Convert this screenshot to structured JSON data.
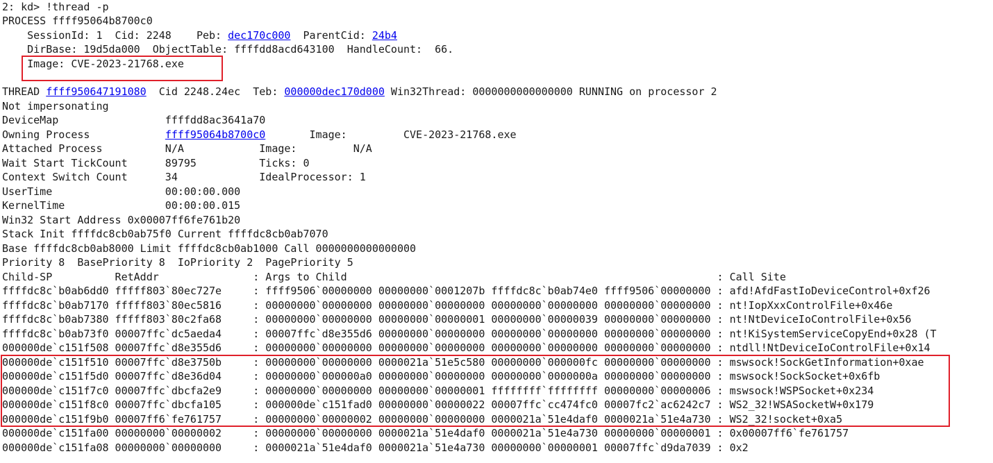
{
  "prompt": "2: kd> !thread -p",
  "process": {
    "label": "PROCESS ffff95064b8700c0",
    "session_pre": "    SessionId: 1  Cid: 2248    Peb: ",
    "peb_link": "dec170c000",
    "parentcid_pre": "  ParentCid: ",
    "parentcid_link": "24b4",
    "dirbase_line": "    DirBase: 19d5da000  ObjectTable: ffffdd8acd643100  HandleCount:  66.",
    "image_line": "    Image: CVE-2023-21768.exe"
  },
  "thread": {
    "pre": "THREAD ",
    "thread_link": "ffff950647191080",
    "cid_teb": "  Cid 2248.24ec  Teb: ",
    "teb_link": "000000dec170d000",
    "rest": " Win32Thread: 0000000000000000 RUNNING on processor 2",
    "impersonating": "Not impersonating",
    "devicemap": "DeviceMap                 ffffdd8ac3641a70",
    "owning_pre": "Owning Process            ",
    "owning_link": "ffff95064b8700c0",
    "owning_post": "       Image:         CVE-2023-21768.exe",
    "attached": "Attached Process          N/A            Image:         N/A",
    "waitstart": "Wait Start TickCount      89795          Ticks: 0",
    "ctxswitch": "Context Switch Count      34             IdealProcessor: 1",
    "usertime": "UserTime                  00:00:00.000",
    "kerneltime": "KernelTime                00:00:00.015",
    "win32start": "Win32 Start Address 0x00007ff6fe761b20",
    "stackinit": "Stack Init ffffdc8cb0ab75f0 Current ffffdc8cb0ab7070",
    "base": "Base ffffdc8cb0ab8000 Limit ffffdc8cb0ab1000 Call 0000000000000000",
    "priority": "Priority 8  BasePriority 8  IoPriority 2  PagePriority 5"
  },
  "stack": {
    "header": "Child-SP          RetAddr               : Args to Child                                                           : Call Site",
    "rows": [
      "ffffdc8c`b0ab6dd0 fffff803`80ec727e     : ffff9506`00000000 00000000`0001207b ffffdc8c`b0ab74e0 ffff9506`00000000 : afd!AfdFastIoDeviceControl+0xf26",
      "ffffdc8c`b0ab7170 fffff803`80ec5816     : 00000000`00000000 00000000`00000000 00000000`00000000 00000000`00000000 : nt!IopXxxControlFile+0x46e",
      "ffffdc8c`b0ab7380 fffff803`80c2fa68     : 00000000`00000000 00000000`00000001 00000000`00000039 00000000`00000000 : nt!NtDeviceIoControlFile+0x56",
      "ffffdc8c`b0ab73f0 00007ffc`dc5aeda4     : 00007ffc`d8e355d6 00000000`00000000 00000000`00000000 00000000`00000000 : nt!KiSystemServiceCopyEnd+0x28 (T",
      "000000de`c151f508 00007ffc`d8e355d6     : 00000000`00000000 00000000`00000000 00000000`00000000 00000000`00000000 : ntdll!NtDeviceIoControlFile+0x14",
      "000000de`c151f510 00007ffc`d8e3750b     : 00000000`00000000 0000021a`51e5c580 00000000`000000fc 00000000`00000000 : mswsock!SockGetInformation+0xae",
      "000000de`c151f5d0 00007ffc`d8e36d04     : 00000000`000000a0 00000000`00000000 00000000`0000000a 00000000`00000000 : mswsock!SockSocket+0x6fb",
      "000000de`c151f7c0 00007ffc`dbcfa2e9     : 00000000`00000000 00000000`00000001 ffffffff`ffffffff 00000000`00000006 : mswsock!WSPSocket+0x234",
      "000000de`c151f8c0 00007ffc`dbcfa105     : 000000de`c151fad0 00000000`00000022 00007ffc`cc474fc0 00007fc2`ac6242c7 : WS2_32!WSASocketW+0x179",
      "000000de`c151f9b0 00007ff6`fe761757     : 00000000`00000002 00000000`00000000 0000021a`51e4daf0 0000021a`51e4a730 : WS2_32!socket+0xa5",
      "000000de`c151fa00 00000000`00000002     : 00000000`00000000 0000021a`51e4daf0 0000021a`51e4a730 00000000`00000001 : 0x00007ff6`fe761757",
      "000000de`c151fa08 00000000`00000000     : 0000021a`51e4daf0 0000021a`51e4a730 00000000`00000001 00007ffc`d9da7039 : 0x2"
    ]
  },
  "colors": {
    "text": "#1a1a1a",
    "link": "#0000ee",
    "highlight": "#e0202a",
    "background": "#ffffff"
  }
}
